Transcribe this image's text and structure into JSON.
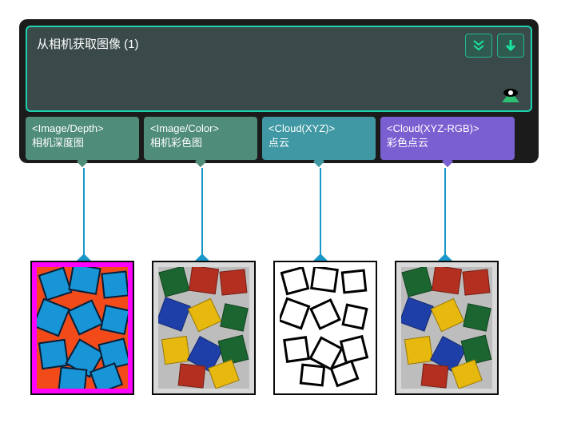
{
  "node": {
    "title": "从相机获取图像 (1)",
    "buttons": {
      "expand_all": "expand-all",
      "download": "download"
    },
    "eye_badge": "visibility-icon"
  },
  "ports": [
    {
      "type": "<Image/Depth>",
      "label": "相机深度图",
      "key": "depth"
    },
    {
      "type": "<Image/Color>",
      "label": "相机彩色图",
      "key": "color"
    },
    {
      "type": "<Cloud(XYZ)>",
      "label": "点云",
      "key": "cloud"
    },
    {
      "type": "<Cloud(XYZ-RGB)>",
      "label": "彩色点云",
      "key": "cloudrgb"
    }
  ],
  "colors": {
    "accent": "#1dd3b0",
    "connector": "#1a97c9",
    "port_image": "#4f8c7a",
    "port_cloud": "#3f98a3",
    "port_cloud_rgb": "#7a5fd1"
  },
  "thumbnails": [
    {
      "key": "depth",
      "alt": "相机深度图 缩略图"
    },
    {
      "key": "color",
      "alt": "相机彩色图 缩略图"
    },
    {
      "key": "cloud",
      "alt": "点云 缩略图"
    },
    {
      "key": "cloudrgb",
      "alt": "彩色点云 缩略图"
    }
  ]
}
